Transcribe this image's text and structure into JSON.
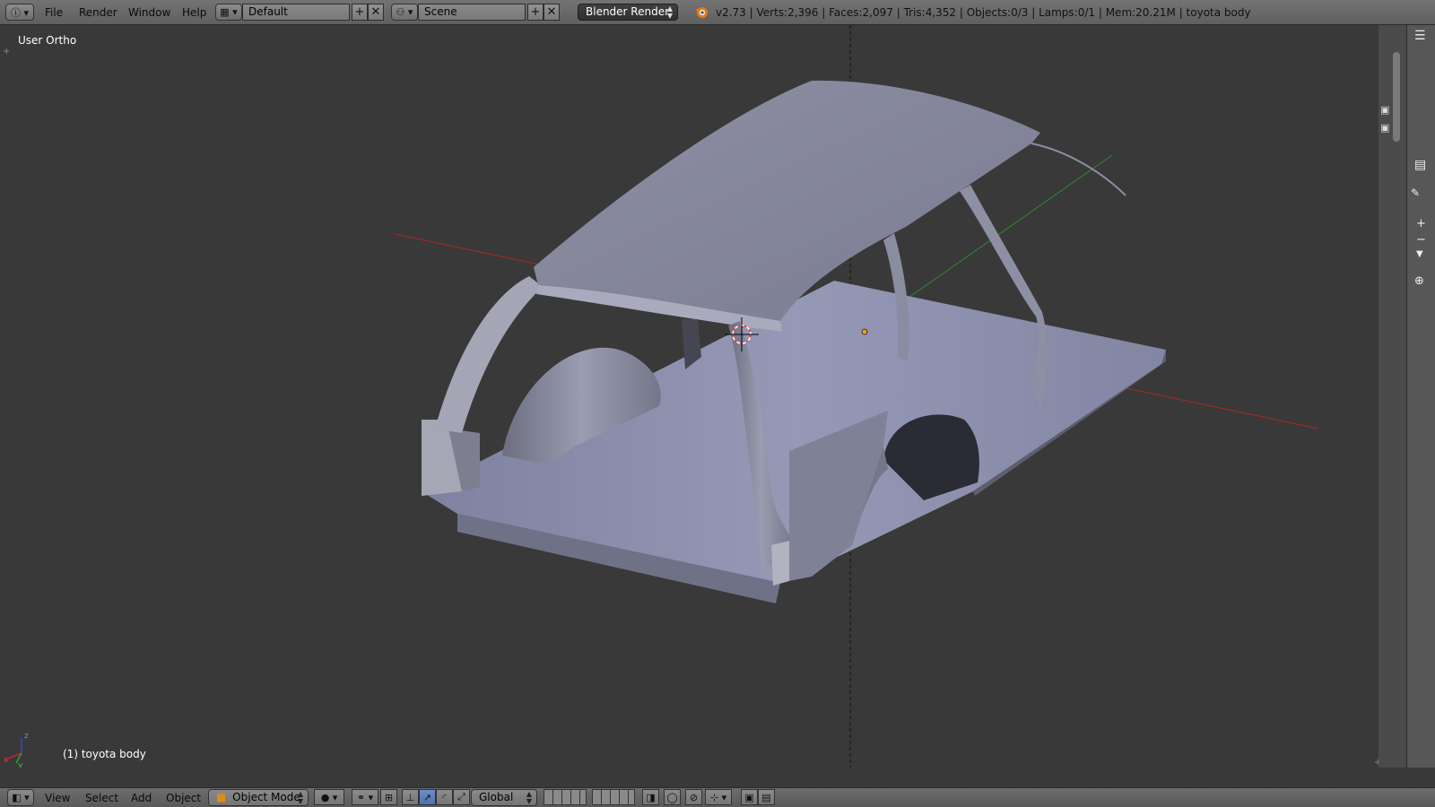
{
  "topbar": {
    "menus": [
      "File",
      "Render",
      "Window",
      "Help"
    ],
    "layout_name": "Default",
    "scene_name": "Scene",
    "render_engine": "Blender Render",
    "stats": "v2.73 | Verts:2,396 | Faces:2,097 | Tris:4,352 | Objects:0/3 | Lamps:0/1 | Mem:20.21M | toyota body"
  },
  "viewport": {
    "view_label": "User Ortho",
    "object_label": "(1) toyota body",
    "axis_labels": {
      "x": "x",
      "y": "y",
      "z": "z"
    }
  },
  "bottombar": {
    "menus": [
      "View",
      "Select",
      "Add",
      "Object"
    ],
    "mode": "Object Mode",
    "orientation": "Global"
  },
  "colors": {
    "viewport_bg": "#393939",
    "x_axis": "#b02626",
    "y_axis": "#2f8a2f",
    "mesh": "#8a8ea6",
    "header": "#6b6b6b"
  }
}
